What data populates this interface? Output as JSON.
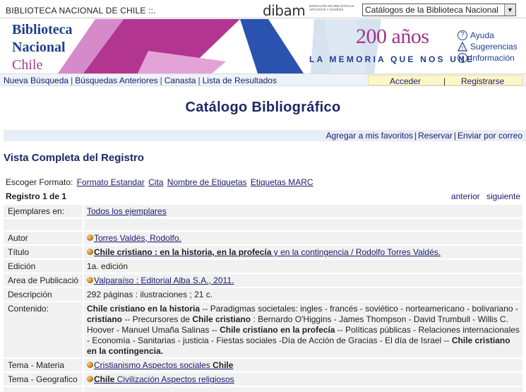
{
  "header": {
    "site_name": "BIBLIOTECA NACIONAL DE CHILE ::.",
    "dibam_logo": "dibam",
    "dibam_subtitle": "DIRECCIÓN DE BIBLIOTECAS ARCHIVOS Y MUSEOS",
    "catalog_select_value": "Catálogos de la Biblioteca Nacional"
  },
  "banner": {
    "line1": "Biblioteca",
    "line2": "Nacional",
    "line3": "Chile",
    "anios": "200 años",
    "memoria": "LA MEMORIA QUE NOS UNE",
    "help": [
      {
        "icon": "question-icon",
        "label": "Ayuda"
      },
      {
        "icon": "warning-icon",
        "label": "Sugerencias"
      },
      {
        "icon": "info-icon",
        "label": "Información"
      }
    ],
    "colors": {
      "blue": "#1f3f8f",
      "magenta": "#a0358c",
      "pink": "#d07cc3",
      "lightblue": "#c7d9ec"
    }
  },
  "nav": {
    "links": [
      "Nueva Búsqueda",
      "Búsquedas Anteriores",
      "Canasta",
      "Lista de Resultados"
    ],
    "acceder": "Acceder",
    "separator": "|",
    "registrarse": "Registrarse"
  },
  "page_title": "Catálogo Bibliográfico",
  "actions": [
    "Agregar a mis favoritos",
    "Reservar",
    "Enviar por correo"
  ],
  "section_title": "Vista Completa del Registro",
  "formats": {
    "label": "Escoger Formato:",
    "options": [
      "Formato Estandar",
      "Cita",
      "Nombre de Etiquetas",
      "Etiquetas MARC"
    ]
  },
  "registro": {
    "label": "Registro 1 de 1",
    "prev": "anterior",
    "next": "siguiente"
  },
  "record": {
    "ejemplares_label": "Ejemplares en:",
    "ejemplares_value": "Todos los ejemplares",
    "autor_label": "Autor",
    "autor_value": "Torres Valdés, Rodolfo.",
    "titulo_label": "Título",
    "titulo_bold": "Chile cristiano : en la historia, en la profecía",
    "titulo_rest": " y en la contingencia / Rodolfo Torres Valdés.",
    "edicion_label": "Edición",
    "edicion_value": "1a. edición",
    "area_label": "Area de Publicació",
    "area_value": "Valparaíso : Editorial Alba S.A., 2011.",
    "descripcion_label": "Descripción",
    "descripcion_value": "292 páginas : ilustraciones ; 21 c.",
    "contenido_label": "Contenido:",
    "contenido_parts": [
      {
        "t": "Chile cristiano en la historia",
        "b": true
      },
      {
        "t": " -- Paradigmas societales: ingles - francés - soviético - norteamericano - bolivariano - ",
        "b": false
      },
      {
        "t": "cristiano",
        "b": true
      },
      {
        "t": " -- Precursores de ",
        "b": false
      },
      {
        "t": "Chile cristiano",
        "b": true
      },
      {
        "t": " : Bernardo O'Higgins - James Thompson - David Trumbull - Willis C. Hoover - Manuel Umaña Salinas -- ",
        "b": false
      },
      {
        "t": "Chile cristiano en la profecía",
        "b": true
      },
      {
        "t": " -- Políticas públicas - Relaciones internacionales - Economía - Sanitarias - justicia - Fiestas sociales -Día de Acción de Gracias - El día de Israel -- ",
        "b": false
      },
      {
        "t": "Chile cristiano en la contingencia.",
        "b": true
      }
    ],
    "tema_materia_label": "Tema - Materia",
    "tema_materia_plain": "Cristianismo Aspectos sociales ",
    "tema_materia_bold": "Chile",
    "tema_geo_label": "Tema - Geografico",
    "tema_geo_bold": "Chile",
    "tema_geo_plain": " Civilización Aspectos religiosos"
  }
}
